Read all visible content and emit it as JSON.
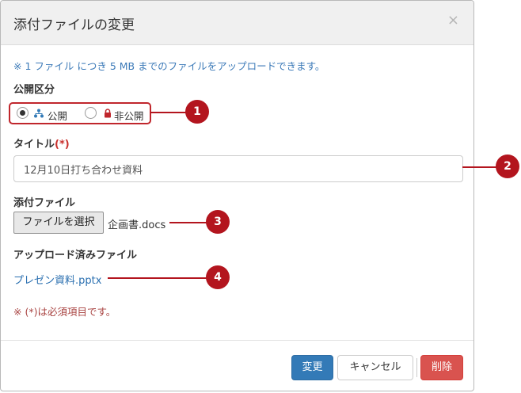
{
  "modal": {
    "title": "添付ファイルの変更",
    "close_symbol": "×"
  },
  "notice": "※ 1 ファイル につき 5 MB までのファイルをアップロードできます。",
  "visibility": {
    "label": "公開区分",
    "options": [
      {
        "label": "公開",
        "icon": "sitemap-icon",
        "selected": true
      },
      {
        "label": "非公開",
        "icon": "lock-icon",
        "selected": false
      }
    ]
  },
  "title_field": {
    "label": "タイトル",
    "required_mark": "(*)",
    "value": "12月10日打ち合わせ資料"
  },
  "attachment": {
    "label": "添付ファイル",
    "choose_button": "ファイルを選択",
    "file_name": "企画書.docs"
  },
  "uploaded": {
    "label": "アップロード済みファイル",
    "file_link": "プレゼン資料.pptx"
  },
  "required_note": "※ (*)は必須項目です。",
  "buttons": {
    "change": "変更",
    "cancel": "キャンセル",
    "delete": "削除"
  },
  "callouts": [
    "1",
    "2",
    "3",
    "4"
  ],
  "colors": {
    "primary": "#337ab7",
    "danger": "#d9534f",
    "callout": "#b3151e",
    "link": "#2a6fb0",
    "notice": "#3c7ab8"
  }
}
